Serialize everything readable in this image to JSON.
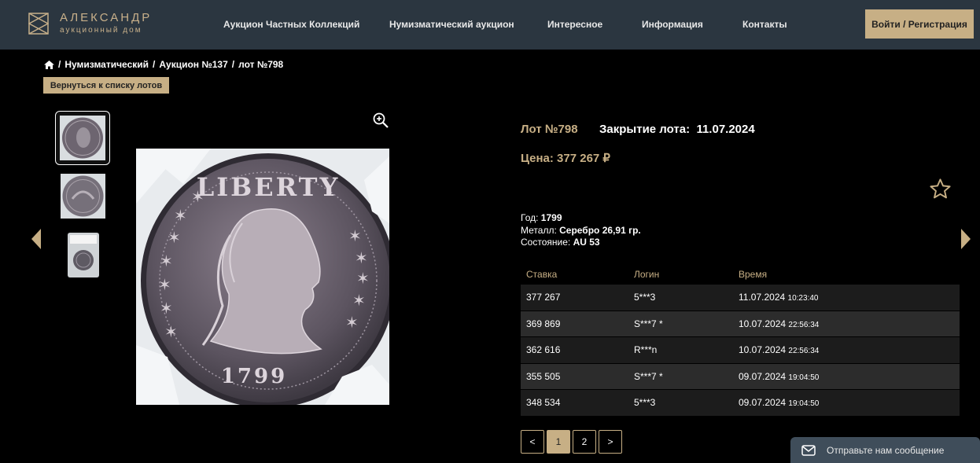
{
  "header": {
    "logo_name": "АЛЕКСАНДР",
    "logo_sub": "аукционный дом",
    "nav": [
      {
        "label": "Аукцион Частных Коллекций"
      },
      {
        "label": "Нумизматический аукцион"
      },
      {
        "label": "Интересное"
      },
      {
        "label": "Информация"
      },
      {
        "label": "Контакты"
      }
    ],
    "login_label": "Войти / Регистрация"
  },
  "breadcrumb": [
    "Нумизматический",
    "Аукцион №137",
    "лот №798"
  ],
  "back_label": "Вернуться к списку лотов",
  "lot": {
    "number": "Лот №798",
    "closing_label": "Закрытие лота:",
    "closing_date": "11.07.2024",
    "price": "Цена: 377 267 ₽",
    "year_label": "Год:",
    "year": "1799",
    "metal_label": "Металл:",
    "metal": "Серебро 26,91 гр.",
    "condition_label": "Состояние:",
    "condition": "AU 53"
  },
  "bids": {
    "headers": [
      "Ставка",
      "Логин",
      "Время"
    ],
    "rows": [
      {
        "bid": "377 267",
        "login": "5***3",
        "date": "11.07.2024",
        "time": "10:23:40"
      },
      {
        "bid": "369 869",
        "login": "S***7 *",
        "date": "10.07.2024",
        "time": "22:56:34"
      },
      {
        "bid": "362 616",
        "login": "R***n",
        "date": "10.07.2024",
        "time": "22:56:34"
      },
      {
        "bid": "355 505",
        "login": "S***7 *",
        "date": "09.07.2024",
        "time": "19:04:50"
      },
      {
        "bid": "348 534",
        "login": "5***3",
        "date": "09.07.2024",
        "time": "19:04:50"
      }
    ]
  },
  "pagination": {
    "prev": "<",
    "pages": [
      "1",
      "2"
    ],
    "next": ">",
    "current": "1"
  },
  "chat_label": "Отправьте нам сообщение",
  "coin": {
    "legend": "LIBERTY",
    "year": "1799"
  },
  "colors": {
    "accent": "#c7af85",
    "header": "#2b3640"
  }
}
